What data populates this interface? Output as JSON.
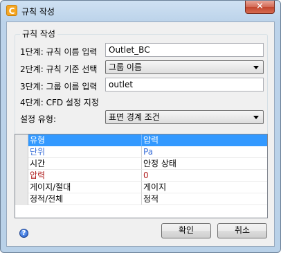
{
  "window": {
    "title": "규칙 작성",
    "close_glyph": "✕",
    "app_icon_letter": "C"
  },
  "group": {
    "title": "규칙 작성",
    "step1_label": "1단계: 규칙 이름 입력",
    "step1_value": "Outlet_BC",
    "step2_label": "2단계: 규칙 기준 선택",
    "step2_value": "그룹 이름",
    "step3_label": "3단계: 그룹 이름 입력",
    "step3_value": "outlet",
    "step4_label": "4단계: CFD 설정 지정",
    "setting_type_label": "설정 유형:",
    "setting_type_value": "표면 경계 조건"
  },
  "grid": {
    "rows": [
      {
        "name": "유형",
        "value": "압력",
        "selected": true,
        "color": ""
      },
      {
        "name": "단위",
        "value": "Pa",
        "selected": false,
        "color": "#3a6fd8"
      },
      {
        "name": "시간",
        "value": "안정 상태",
        "selected": false,
        "color": "#000000"
      },
      {
        "name": "압력",
        "value": "0",
        "selected": false,
        "color": "#b01f1f"
      },
      {
        "name": "게이지/절대",
        "value": "게이지",
        "selected": false,
        "color": "#000000"
      },
      {
        "name": "정적/전체",
        "value": "정적",
        "selected": false,
        "color": "#000000"
      }
    ]
  },
  "buttons": {
    "ok": "확인",
    "cancel": "취소"
  },
  "help_glyph": "?"
}
